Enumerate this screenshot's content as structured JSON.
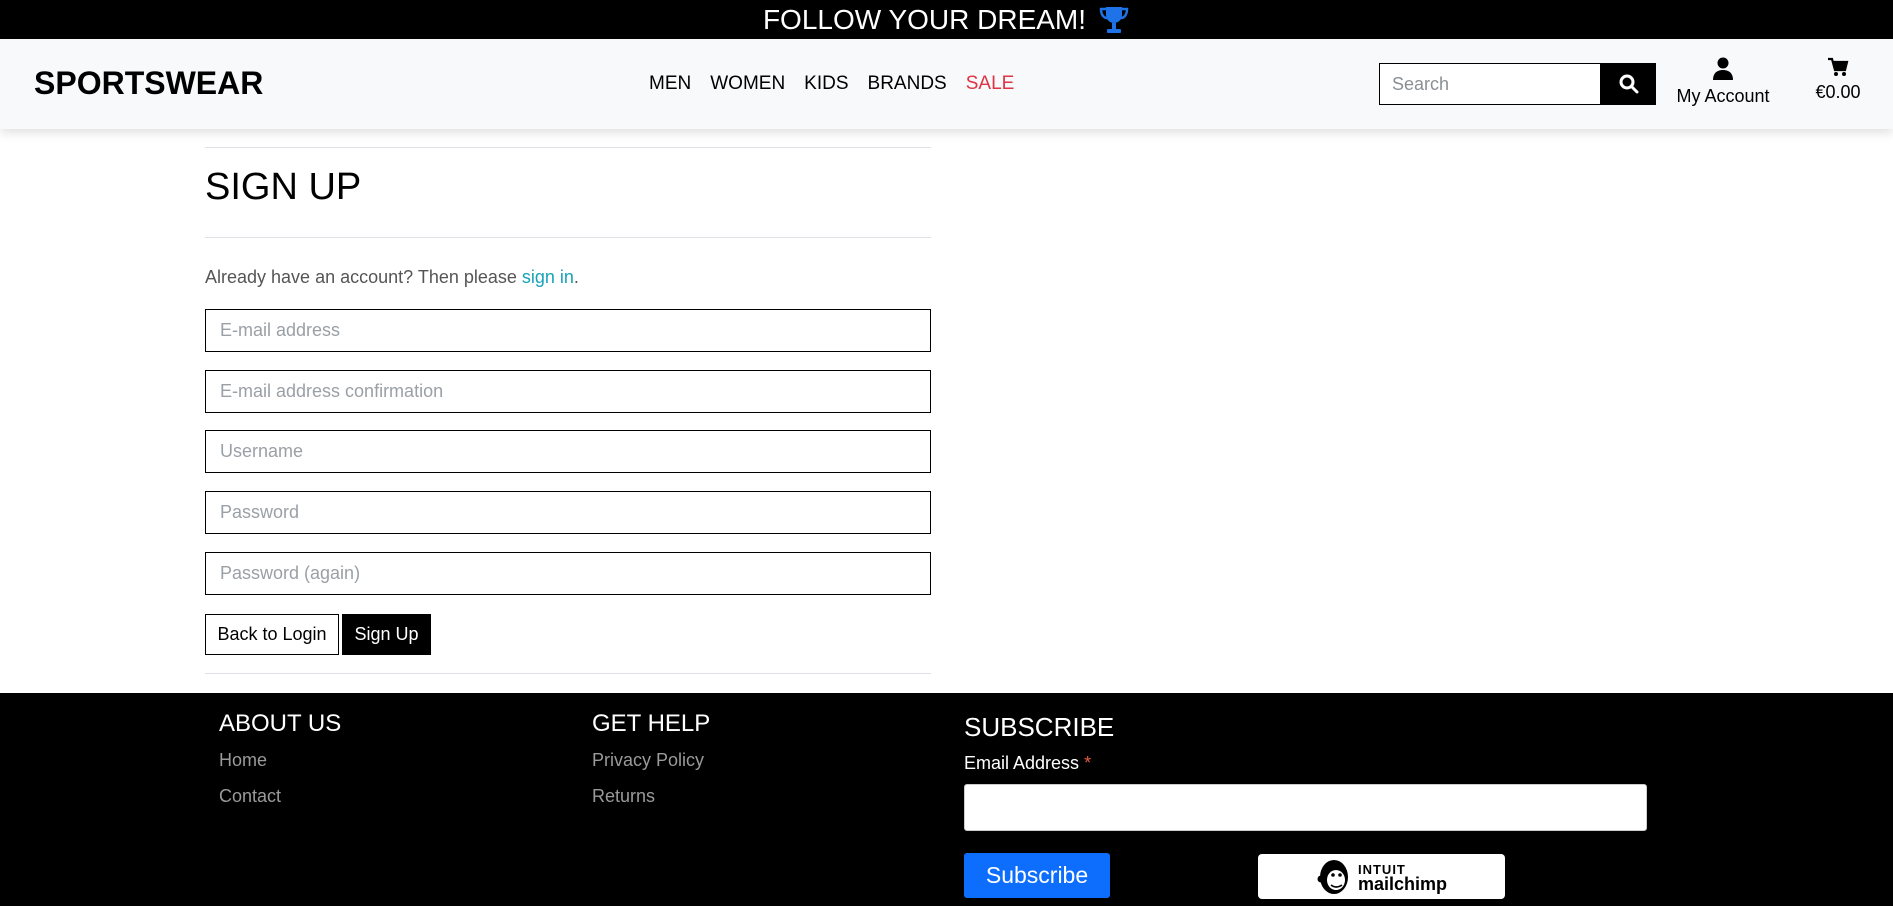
{
  "banner": {
    "text": "FOLLOW YOUR DREAM!",
    "icon": "trophy-icon",
    "icon_color": "#1e73e8"
  },
  "header": {
    "logo": "SPORTSWEAR",
    "nav": [
      "MEN",
      "WOMEN",
      "KIDS",
      "BRANDS",
      "SALE"
    ],
    "search_placeholder": "Search",
    "account_label": "My Account",
    "cart_total": "€0.00"
  },
  "signup": {
    "title": "SIGN UP",
    "already_text": "Already have an account? Then please ",
    "signin_link": "sign in",
    "period": ".",
    "fields": {
      "email": "E-mail address",
      "email_confirm": "E-mail address confirmation",
      "username": "Username",
      "password": "Password",
      "password_again": "Password (again)"
    },
    "back_button": "Back to Login",
    "signup_button": "Sign Up"
  },
  "footer": {
    "about_title": "ABOUT US",
    "about_links": [
      "Home",
      "Contact"
    ],
    "help_title": "GET HELP",
    "help_links": [
      "Privacy Policy",
      "Returns"
    ],
    "subscribe_title": "SUBSCRIBE",
    "email_label": "Email Address",
    "required_mark": "*",
    "subscribe_button": "Subscribe",
    "mailchimp_badge": {
      "top": "INTUIT",
      "bottom": "mailchimp"
    }
  },
  "colors": {
    "sale": "#dc3545",
    "link": "#17a2b8",
    "subscribe": "#0d6efd"
  }
}
